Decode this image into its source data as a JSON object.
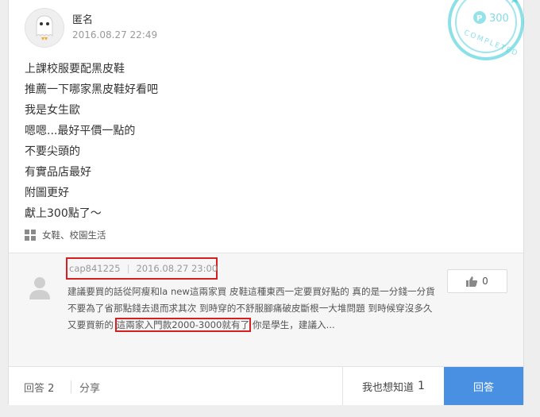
{
  "question": {
    "user": "匿名",
    "time": "2016.08.27 22:49",
    "stamp": {
      "points": "300",
      "text": "COMPLETED"
    },
    "lines": [
      "上課校服要配黑皮鞋",
      "推薦一下哪家黑皮鞋好看吧",
      "我是女生歐",
      "嗯嗯...最好平價一點的",
      "不要尖頭的",
      "有實品店最好",
      "附圖更好",
      "獻上300點了～"
    ],
    "tags": "女鞋、校園生活"
  },
  "answer": {
    "user": "cap841225",
    "time": "2016.08.27 23:00",
    "text_before": "建議要買的話從阿瘦和la new這兩家買 皮鞋這種東西一定要買好點的 真的是一分錢一分貨 不要為了省那點錢去退而求其次 到時穿的不舒服腳痛破皮斷根一大堆問題 到時候穿沒多久又要買新的 ",
    "text_highlight": "這兩家入門款2000-3000就有了",
    "text_after": " 你是學生，建議入...",
    "likes": "0"
  },
  "footer": {
    "answers_label": "回答",
    "answers_count": "2",
    "share_label": "分享",
    "want_know_label": "我也想知道",
    "want_know_count": "1",
    "answer_button": "回答"
  },
  "colors": {
    "accent": "#4a90e2",
    "highlight_box": "#d62020",
    "stamp": "#2dc6d6"
  }
}
